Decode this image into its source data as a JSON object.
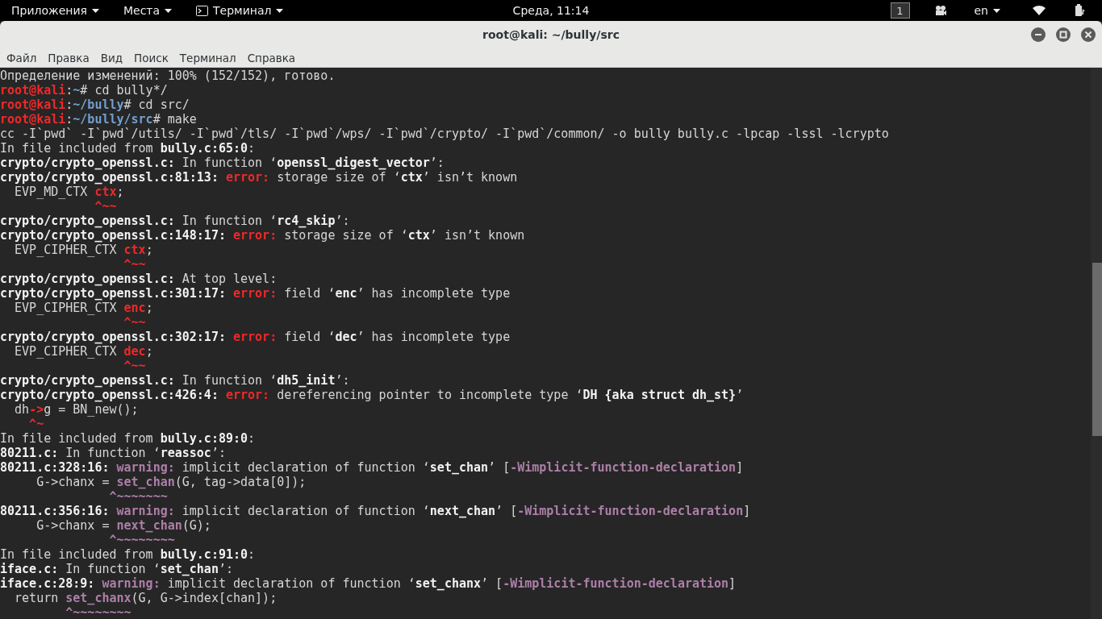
{
  "top_bar": {
    "menus": [
      {
        "label": "Приложения",
        "kind": "menu"
      },
      {
        "label": "Места",
        "kind": "menu"
      },
      {
        "label": "Терминал",
        "kind": "app"
      }
    ],
    "clock": "Среда, 11:14",
    "workspace": "1",
    "language": "en"
  },
  "window": {
    "title": "root@kali: ~/bully/src"
  },
  "menu_bar": [
    "Файл",
    "Правка",
    "Вид",
    "Поиск",
    "Терминал",
    "Справка"
  ],
  "terminal": {
    "lines": [
      [
        {
          "t": "Определение изменений: 100% (152/152), готово.",
          "kind": "plain"
        }
      ],
      [
        {
          "t": "root@kali",
          "kind": "user"
        },
        {
          "t": ":",
          "kind": "plain"
        },
        {
          "t": "~",
          "kind": "path"
        },
        {
          "t": "# cd bully*/",
          "kind": "plain"
        }
      ],
      [
        {
          "t": "root@kali",
          "kind": "user"
        },
        {
          "t": ":",
          "kind": "plain"
        },
        {
          "t": "~/bully",
          "kind": "path"
        },
        {
          "t": "# cd src/",
          "kind": "plain"
        }
      ],
      [
        {
          "t": "root@kali",
          "kind": "user"
        },
        {
          "t": ":",
          "kind": "plain"
        },
        {
          "t": "~/bully/src",
          "kind": "path"
        },
        {
          "t": "# make",
          "kind": "plain"
        }
      ],
      [
        {
          "t": "cc -I`pwd` -I`pwd`/utils/ -I`pwd`/tls/ -I`pwd`/wps/ -I`pwd`/crypto/ -I`pwd`/common/ -o bully bully.c -lpcap -lssl -lcrypto",
          "kind": "plain"
        }
      ],
      [
        {
          "t": "In file included from ",
          "kind": "plain"
        },
        {
          "t": "bully.c:65:0",
          "kind": "bold"
        },
        {
          "t": ":",
          "kind": "plain"
        }
      ],
      [
        {
          "t": "crypto/crypto_openssl.c:",
          "kind": "bold"
        },
        {
          "t": " In function ‘",
          "kind": "plain"
        },
        {
          "t": "openssl_digest_vector",
          "kind": "bold"
        },
        {
          "t": "’:",
          "kind": "plain"
        }
      ],
      [
        {
          "t": "crypto/crypto_openssl.c:81:13: ",
          "kind": "bold"
        },
        {
          "t": "error:",
          "kind": "error"
        },
        {
          "t": " storage size of ‘",
          "kind": "plain"
        },
        {
          "t": "ctx",
          "kind": "bold"
        },
        {
          "t": "’ isn’t known",
          "kind": "plain"
        }
      ],
      [
        {
          "t": "  EVP_MD_CTX ",
          "kind": "plain"
        },
        {
          "t": "ctx",
          "kind": "error"
        },
        {
          "t": ";",
          "kind": "plain"
        }
      ],
      [
        {
          "t": "             ^~~",
          "kind": "error"
        }
      ],
      [
        {
          "t": "crypto/crypto_openssl.c:",
          "kind": "bold"
        },
        {
          "t": " In function ‘",
          "kind": "plain"
        },
        {
          "t": "rc4_skip",
          "kind": "bold"
        },
        {
          "t": "’:",
          "kind": "plain"
        }
      ],
      [
        {
          "t": "crypto/crypto_openssl.c:148:17: ",
          "kind": "bold"
        },
        {
          "t": "error:",
          "kind": "error"
        },
        {
          "t": " storage size of ‘",
          "kind": "plain"
        },
        {
          "t": "ctx",
          "kind": "bold"
        },
        {
          "t": "’ isn’t known",
          "kind": "plain"
        }
      ],
      [
        {
          "t": "  EVP_CIPHER_CTX ",
          "kind": "plain"
        },
        {
          "t": "ctx",
          "kind": "error"
        },
        {
          "t": ";",
          "kind": "plain"
        }
      ],
      [
        {
          "t": "                 ^~~",
          "kind": "error"
        }
      ],
      [
        {
          "t": "crypto/crypto_openssl.c:",
          "kind": "bold"
        },
        {
          "t": " At top level:",
          "kind": "plain"
        }
      ],
      [
        {
          "t": "crypto/crypto_openssl.c:301:17: ",
          "kind": "bold"
        },
        {
          "t": "error:",
          "kind": "error"
        },
        {
          "t": " field ‘",
          "kind": "plain"
        },
        {
          "t": "enc",
          "kind": "bold"
        },
        {
          "t": "’ has incomplete type",
          "kind": "plain"
        }
      ],
      [
        {
          "t": "  EVP_CIPHER_CTX ",
          "kind": "plain"
        },
        {
          "t": "enc",
          "kind": "error"
        },
        {
          "t": ";",
          "kind": "plain"
        }
      ],
      [
        {
          "t": "                 ^~~",
          "kind": "error"
        }
      ],
      [
        {
          "t": "crypto/crypto_openssl.c:302:17: ",
          "kind": "bold"
        },
        {
          "t": "error:",
          "kind": "error"
        },
        {
          "t": " field ‘",
          "kind": "plain"
        },
        {
          "t": "dec",
          "kind": "bold"
        },
        {
          "t": "’ has incomplete type",
          "kind": "plain"
        }
      ],
      [
        {
          "t": "  EVP_CIPHER_CTX ",
          "kind": "plain"
        },
        {
          "t": "dec",
          "kind": "error"
        },
        {
          "t": ";",
          "kind": "plain"
        }
      ],
      [
        {
          "t": "                 ^~~",
          "kind": "error"
        }
      ],
      [
        {
          "t": "crypto/crypto_openssl.c:",
          "kind": "bold"
        },
        {
          "t": " In function ‘",
          "kind": "plain"
        },
        {
          "t": "dh5_init",
          "kind": "bold"
        },
        {
          "t": "’:",
          "kind": "plain"
        }
      ],
      [
        {
          "t": "crypto/crypto_openssl.c:426:4: ",
          "kind": "bold"
        },
        {
          "t": "error:",
          "kind": "error"
        },
        {
          "t": " dereferencing pointer to incomplete type ‘",
          "kind": "plain"
        },
        {
          "t": "DH {aka struct dh_st}",
          "kind": "bold"
        },
        {
          "t": "’",
          "kind": "plain"
        }
      ],
      [
        {
          "t": "  dh",
          "kind": "plain"
        },
        {
          "t": "->",
          "kind": "error"
        },
        {
          "t": "g = BN_new();",
          "kind": "plain"
        }
      ],
      [
        {
          "t": "    ^~",
          "kind": "error"
        }
      ],
      [
        {
          "t": "In file included from ",
          "kind": "plain"
        },
        {
          "t": "bully.c:89:0",
          "kind": "bold"
        },
        {
          "t": ":",
          "kind": "plain"
        }
      ],
      [
        {
          "t": "80211.c:",
          "kind": "bold"
        },
        {
          "t": " In function ‘",
          "kind": "plain"
        },
        {
          "t": "reassoc",
          "kind": "bold"
        },
        {
          "t": "’:",
          "kind": "plain"
        }
      ],
      [
        {
          "t": "80211.c:328:16: ",
          "kind": "bold"
        },
        {
          "t": "warning:",
          "kind": "warning"
        },
        {
          "t": " implicit declaration of function ‘",
          "kind": "plain"
        },
        {
          "t": "set_chan",
          "kind": "bold"
        },
        {
          "t": "’ [",
          "kind": "plain"
        },
        {
          "t": "-Wimplicit-function-declaration",
          "kind": "warning"
        },
        {
          "t": "]",
          "kind": "plain"
        }
      ],
      [
        {
          "t": "     G->chanx = ",
          "kind": "plain"
        },
        {
          "t": "set_chan",
          "kind": "warning"
        },
        {
          "t": "(G, tag->data[0]);",
          "kind": "plain"
        }
      ],
      [
        {
          "t": "               ^~~~~~~~",
          "kind": "warning"
        }
      ],
      [
        {
          "t": "80211.c:356:16: ",
          "kind": "bold"
        },
        {
          "t": "warning:",
          "kind": "warning"
        },
        {
          "t": " implicit declaration of function ‘",
          "kind": "plain"
        },
        {
          "t": "next_chan",
          "kind": "bold"
        },
        {
          "t": "’ [",
          "kind": "plain"
        },
        {
          "t": "-Wimplicit-function-declaration",
          "kind": "warning"
        },
        {
          "t": "]",
          "kind": "plain"
        }
      ],
      [
        {
          "t": "     G->chanx = ",
          "kind": "plain"
        },
        {
          "t": "next_chan",
          "kind": "warning"
        },
        {
          "t": "(G);",
          "kind": "plain"
        }
      ],
      [
        {
          "t": "               ^~~~~~~~~",
          "kind": "warning"
        }
      ],
      [
        {
          "t": "In file included from ",
          "kind": "plain"
        },
        {
          "t": "bully.c:91:0",
          "kind": "bold"
        },
        {
          "t": ":",
          "kind": "plain"
        }
      ],
      [
        {
          "t": "iface.c:",
          "kind": "bold"
        },
        {
          "t": " In function ‘",
          "kind": "plain"
        },
        {
          "t": "set_chan",
          "kind": "bold"
        },
        {
          "t": "’:",
          "kind": "plain"
        }
      ],
      [
        {
          "t": "iface.c:28:9: ",
          "kind": "bold"
        },
        {
          "t": "warning:",
          "kind": "warning"
        },
        {
          "t": " implicit declaration of function ‘",
          "kind": "plain"
        },
        {
          "t": "set_chanx",
          "kind": "bold"
        },
        {
          "t": "’ [",
          "kind": "plain"
        },
        {
          "t": "-Wimplicit-function-declaration",
          "kind": "warning"
        },
        {
          "t": "]",
          "kind": "plain"
        }
      ],
      [
        {
          "t": "  return ",
          "kind": "plain"
        },
        {
          "t": "set_chanx",
          "kind": "warning"
        },
        {
          "t": "(G, G->index[chan]);",
          "kind": "plain"
        }
      ],
      [
        {
          "t": "         ^~~~~~~~~",
          "kind": "warning"
        }
      ]
    ]
  }
}
